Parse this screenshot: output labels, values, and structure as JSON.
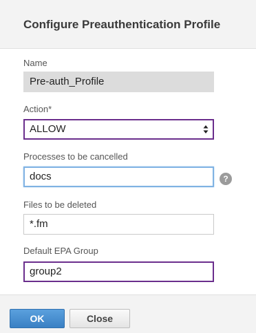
{
  "dialog": {
    "title": "Configure Preauthentication Profile"
  },
  "form": {
    "name": {
      "label": "Name",
      "value": "Pre-auth_Profile"
    },
    "action": {
      "label": "Action*",
      "value": "ALLOW"
    },
    "processes": {
      "label": "Processes to be cancelled",
      "value": "docs",
      "help_icon": "?"
    },
    "files": {
      "label": "Files to be deleted",
      "value": "*.fm"
    },
    "epa_group": {
      "label": "Default EPA Group",
      "value": "group2"
    }
  },
  "footer": {
    "ok_label": "OK",
    "close_label": "Close"
  },
  "colors": {
    "accent_purple": "#6a2d8c",
    "focus_blue": "#7fb2e3",
    "ok_button": "#4a90d2"
  }
}
